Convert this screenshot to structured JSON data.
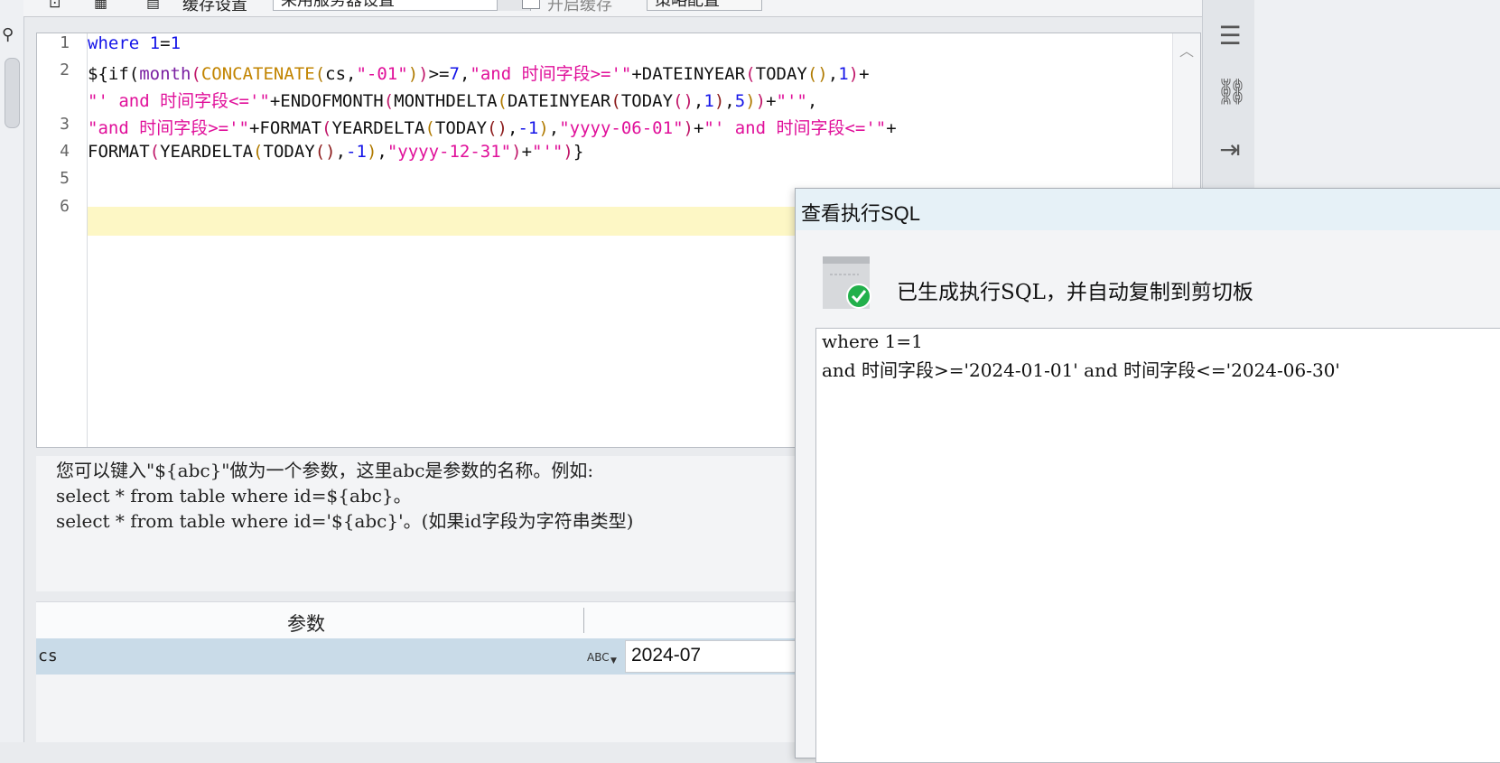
{
  "toolbar": {
    "option_label": "缓存设置",
    "select_value": "采用服务器设置",
    "checkbox_label": "开启缓存",
    "strategy_button": "策略配置"
  },
  "editor": {
    "line_numbers": [
      "1",
      "2",
      "",
      "3",
      "4",
      "5",
      "6"
    ]
  },
  "hint": {
    "line1": "您可以键入\"${abc}\"做为一个参数，这里abc是参数的名称。例如:",
    "line2": "select * from table where id=${abc}。",
    "line3": "select * from table where id='${abc}'。(如果id字段为字符串类型)"
  },
  "params": {
    "header": "参数",
    "row_name": "cs",
    "row_type_icon": "ABC",
    "row_value": "2024-07"
  },
  "dialog": {
    "title": "查看执行SQL",
    "message": "已生成执行SQL，并自动复制到剪切板",
    "sql_lines": [
      "where 1=1",
      "and 时间字段>='2024-01-01' and 时间字段<='2024-06-30'"
    ]
  },
  "icons": {
    "sidebar": [
      "align-icon",
      "link-icon",
      "import-icon"
    ],
    "success_color": "#22b04b"
  }
}
